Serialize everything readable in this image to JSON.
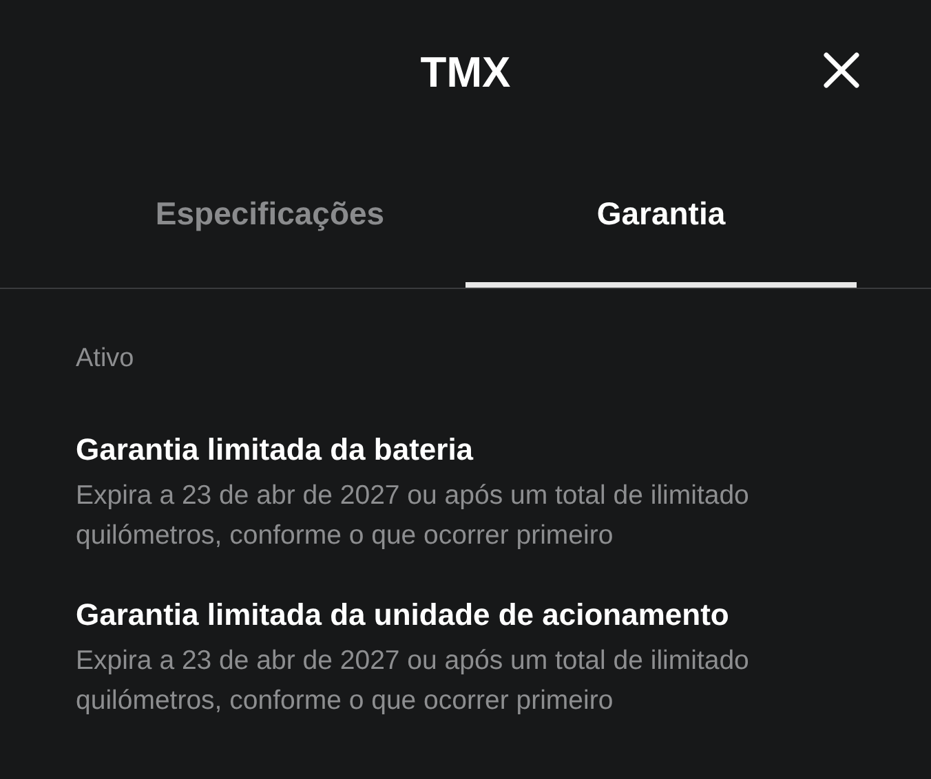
{
  "header": {
    "title": "TMX"
  },
  "tabs": [
    {
      "label": "Especificações",
      "selected": false
    },
    {
      "label": "Garantia",
      "selected": true
    }
  ],
  "section": {
    "heading": "Ativo"
  },
  "warranties": [
    {
      "title": "Garantia limitada da bateria",
      "description": "Expira a 23 de abr de 2027 ou após um total de ilimitado quilómetros, conforme o que ocorrer primeiro"
    },
    {
      "title": "Garantia limitada da unidade de acionamento",
      "description": "Expira a 23 de abr de 2027 ou após um total de ilimitado quilómetros, conforme o que ocorrer primeiro"
    }
  ]
}
